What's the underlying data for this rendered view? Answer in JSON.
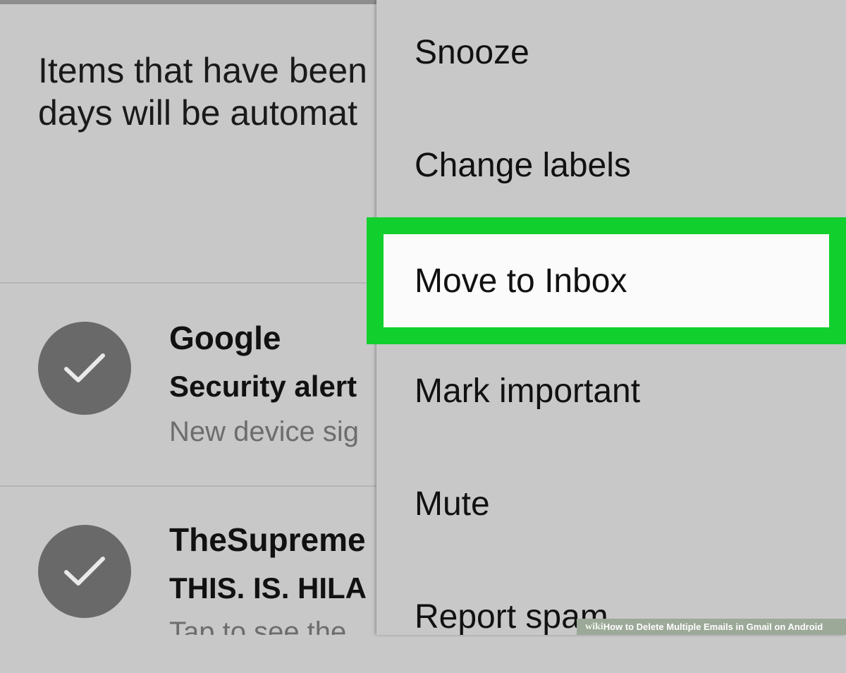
{
  "notice": {
    "line1": "Items that have been",
    "line2": "days will be automat"
  },
  "emails": [
    {
      "sender": "Google",
      "subject": "Security alert",
      "snippet": "New device sig",
      "selected": true
    },
    {
      "sender": "TheSupreme",
      "subject": "THIS. IS. HILA",
      "snippet": "Tap to see the",
      "selected": true
    }
  ],
  "menu": {
    "items": [
      {
        "label": "Snooze"
      },
      {
        "label": "Change labels"
      },
      {
        "label": "Move to Inbox"
      },
      {
        "label": "Mark important"
      },
      {
        "label": "Mute"
      },
      {
        "label": "Report spam"
      }
    ]
  },
  "colors": {
    "highlight": "#11d02e",
    "background": "#c9c8c9",
    "avatar": "#6a696a"
  },
  "icons": {
    "selected": "checkmark-icon"
  },
  "footer": {
    "brand": "wiki",
    "caption": "How to Delete Multiple Emails in Gmail on Android"
  }
}
